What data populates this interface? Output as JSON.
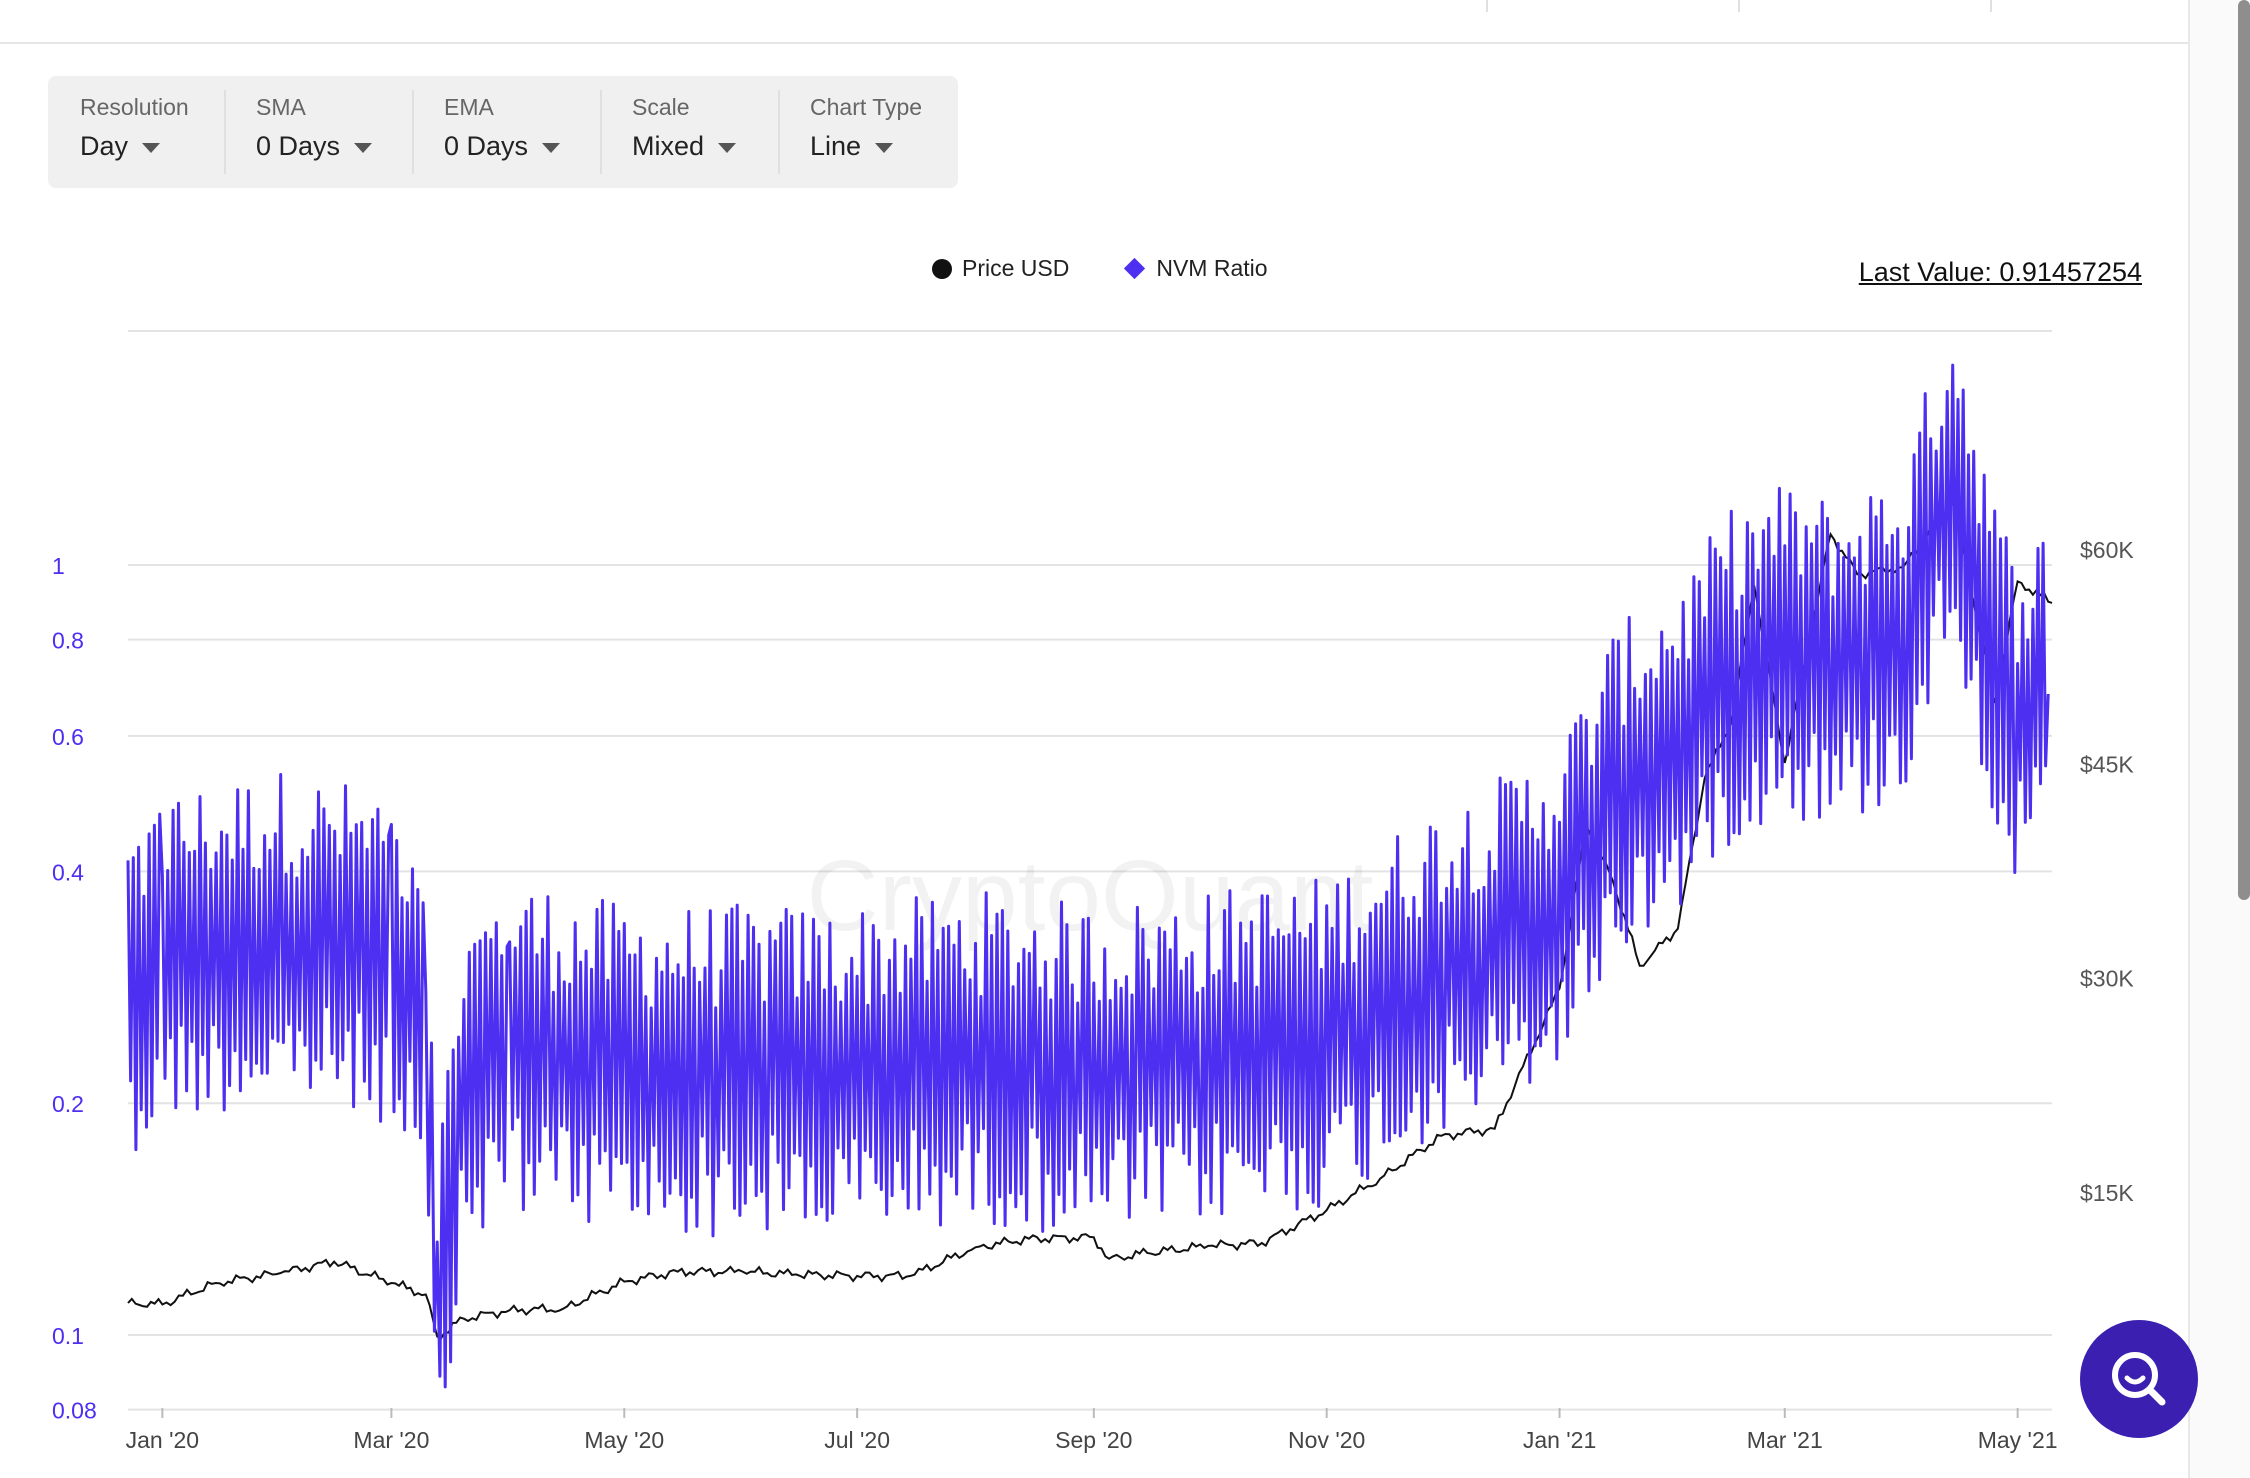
{
  "toolbar": {
    "items": [
      {
        "label": "Resolution",
        "value": "Day"
      },
      {
        "label": "SMA",
        "value": "0 Days"
      },
      {
        "label": "EMA",
        "value": "0 Days"
      },
      {
        "label": "Scale",
        "value": "Mixed"
      },
      {
        "label": "Chart Type",
        "value": "Line"
      }
    ]
  },
  "last_value": "Last Value: 0.91457254",
  "watermark": "CryptoQuant",
  "colors": {
    "price": "#111111",
    "nvm": "#4c2ff0",
    "fab": "#3b1fb0",
    "grid": "#e3e3e3"
  },
  "fab": {
    "icon": "search-icon"
  },
  "chart_data": {
    "type": "line",
    "title": "",
    "legend": "top-center",
    "grid": true,
    "x_ticks": [
      "Jan '20",
      "Mar '20",
      "May '20",
      "Jul '20",
      "Sep '20",
      "Nov '20",
      "Jan '21",
      "Mar '21",
      "May '21"
    ],
    "x_tick_dates": [
      "2020-01-01",
      "2020-03-01",
      "2020-05-01",
      "2020-07-01",
      "2020-09-01",
      "2020-11-01",
      "2021-01-01",
      "2021-03-01",
      "2021-05-01"
    ],
    "xlim": [
      "2019-12-23",
      "2021-05-10"
    ],
    "y_left": {
      "scale": "log",
      "ticks": [
        "0.08",
        "0.1",
        "0.2",
        "0.4",
        "0.6",
        "0.8",
        "1"
      ],
      "tick_values": [
        0.08,
        0.1,
        0.2,
        0.4,
        0.6,
        0.8,
        1
      ],
      "ylim": [
        0.08,
        2.0
      ]
    },
    "y_right": {
      "scale": "linear",
      "ticks": [
        "$15K",
        "$30K",
        "$45K",
        "$60K"
      ],
      "tick_values": [
        15000,
        30000,
        45000,
        60000
      ]
    },
    "series": [
      {
        "name": "Price USD",
        "axis": "right",
        "x": [
          "2019-12-23",
          "2020-01-01",
          "2020-01-15",
          "2020-02-01",
          "2020-02-15",
          "2020-03-01",
          "2020-03-10",
          "2020-03-13",
          "2020-03-20",
          "2020-04-01",
          "2020-04-15",
          "2020-05-01",
          "2020-05-15",
          "2020-06-01",
          "2020-06-15",
          "2020-07-01",
          "2020-07-15",
          "2020-08-01",
          "2020-08-15",
          "2020-09-01",
          "2020-09-05",
          "2020-09-15",
          "2020-10-01",
          "2020-10-15",
          "2020-11-01",
          "2020-11-15",
          "2020-12-01",
          "2020-12-15",
          "2021-01-01",
          "2021-01-08",
          "2021-01-15",
          "2021-01-22",
          "2021-02-01",
          "2021-02-08",
          "2021-02-15",
          "2021-02-21",
          "2021-03-01",
          "2021-03-13",
          "2021-03-20",
          "2021-04-01",
          "2021-04-14",
          "2021-04-25",
          "2021-05-01",
          "2021-05-10"
        ],
        "values": [
          7300,
          7200,
          8700,
          9400,
          10200,
          8700,
          7900,
          4950,
          6200,
          6800,
          6900,
          8800,
          9500,
          9500,
          9300,
          9200,
          9200,
          11200,
          11800,
          11900,
          10400,
          10800,
          11300,
          11500,
          13800,
          16000,
          19000,
          19500,
          29300,
          40700,
          36800,
          30900,
          33500,
          44000,
          48000,
          57500,
          45100,
          61100,
          58300,
          58800,
          63500,
          49300,
          57800,
          56300
        ]
      },
      {
        "name": "NVM Ratio",
        "axis": "left",
        "x": [
          "2019-12-23",
          "2020-01-01",
          "2020-02-01",
          "2020-03-01",
          "2020-03-10",
          "2020-03-13",
          "2020-03-20",
          "2020-04-01",
          "2020-05-01",
          "2020-06-01",
          "2020-07-01",
          "2020-08-01",
          "2020-09-01",
          "2020-10-01",
          "2020-11-01",
          "2020-12-01",
          "2020-12-15",
          "2021-01-01",
          "2021-01-15",
          "2021-02-01",
          "2021-02-15",
          "2021-03-01",
          "2021-03-15",
          "2021-04-01",
          "2021-04-14",
          "2021-04-25",
          "2021-05-01",
          "2021-05-05",
          "2021-05-09"
        ],
        "values": [
          0.28,
          0.31,
          0.33,
          0.31,
          0.28,
          0.11,
          0.21,
          0.24,
          0.22,
          0.22,
          0.22,
          0.23,
          0.22,
          0.23,
          0.24,
          0.3,
          0.32,
          0.36,
          0.5,
          0.58,
          0.72,
          0.78,
          0.74,
          0.82,
          1.35,
          0.75,
          0.62,
          0.68,
          0.68
        ]
      }
    ]
  }
}
